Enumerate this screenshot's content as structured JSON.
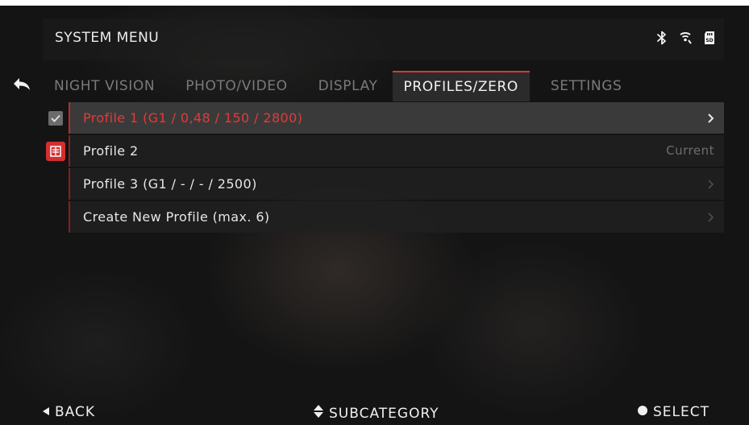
{
  "header": {
    "title": "SYSTEM MENU",
    "icons": [
      "bluetooth-icon",
      "wifi-icon",
      "sd-card-icon"
    ]
  },
  "tabs": [
    {
      "label": "NIGHT VISION",
      "active": false
    },
    {
      "label": "PHOTO/VIDEO",
      "active": false
    },
    {
      "label": "DISPLAY",
      "active": false
    },
    {
      "label": "PROFILES/ZERO",
      "active": true
    },
    {
      "label": "SETTINGS",
      "active": false
    }
  ],
  "profiles": [
    {
      "label": "Profile 1 (G1 / 0,48 / 150 / 2800)",
      "selected": true,
      "marker": "check-icon",
      "right": ""
    },
    {
      "label": "Profile 2",
      "selected": false,
      "marker": "profile-badge-icon",
      "right": "Current"
    },
    {
      "label": "Profile 3 (G1 / - / - / 2500)",
      "selected": false,
      "marker": "",
      "right": ""
    },
    {
      "label": "Create New Profile (max. 6)",
      "selected": false,
      "marker": "",
      "right": ""
    }
  ],
  "footer": {
    "back_label": "BACK",
    "subcategory_label": "SUBCATEGORY",
    "select_label": "SELECT"
  },
  "colors": {
    "accent": "#d63a3a",
    "background": "#141414",
    "text": "#e6e6e6",
    "muted": "#7a7a7a"
  }
}
